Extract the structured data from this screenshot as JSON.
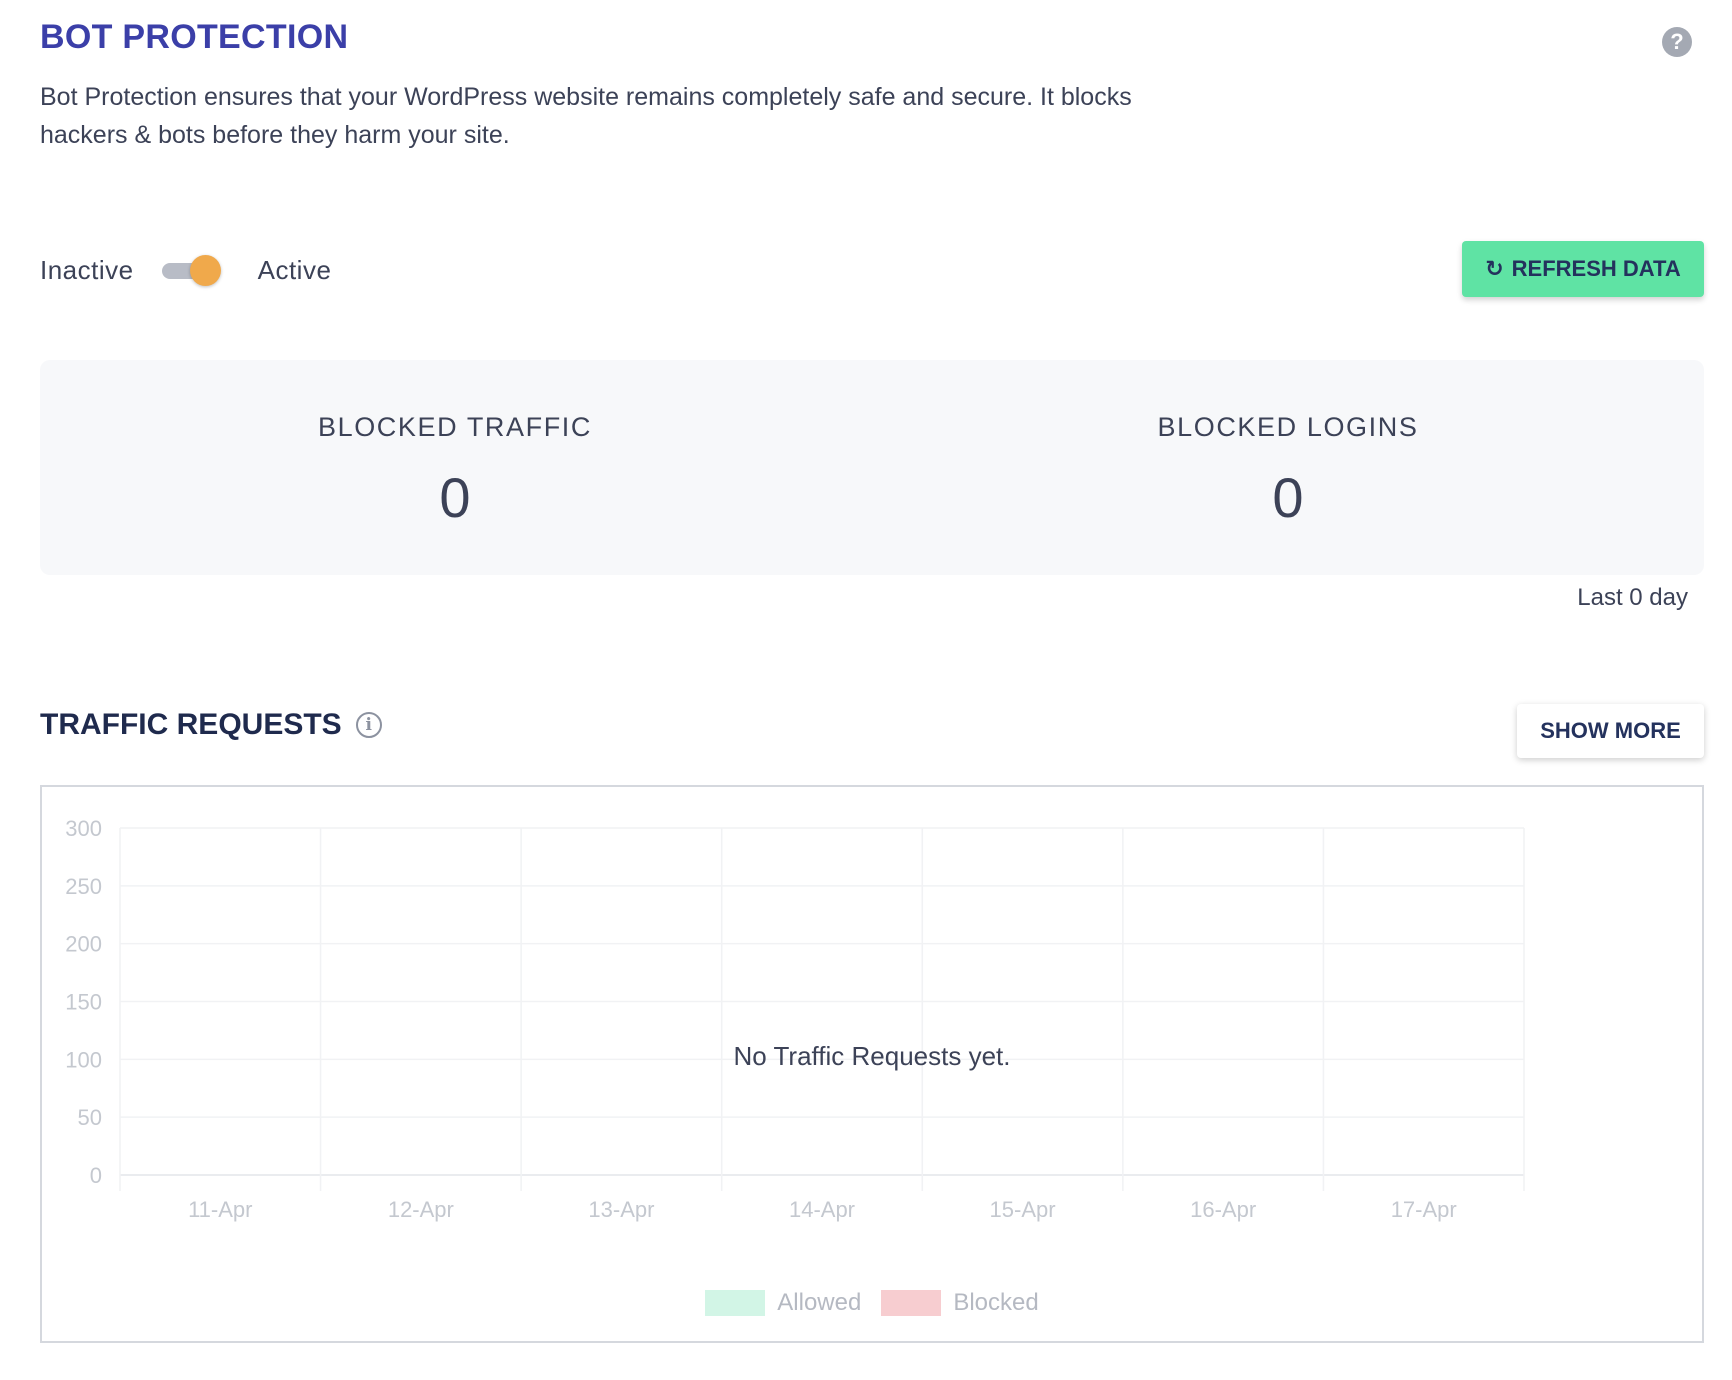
{
  "header": {
    "title": "BOT PROTECTION",
    "help_icon": "?",
    "description": "Bot Protection ensures that your WordPress website remains completely safe and secure. It blocks hackers & bots before they harm your site."
  },
  "status": {
    "inactive_label": "Inactive",
    "active_label": "Active",
    "is_active": true
  },
  "toolbar": {
    "refresh_icon": "↻",
    "refresh_label": "REFRESH DATA"
  },
  "stats": {
    "blocked_traffic_label": "BLOCKED TRAFFIC",
    "blocked_traffic_value": "0",
    "blocked_logins_label": "BLOCKED LOGINS",
    "blocked_logins_value": "0",
    "period": "Last 0 day"
  },
  "traffic": {
    "title": "TRAFFIC REQUESTS",
    "info_icon": "i",
    "show_more_label": "SHOW MORE",
    "empty_message": "No Traffic Requests yet."
  },
  "colors": {
    "accent": "#3b3fa8",
    "refresh_button": "#5fe3a4",
    "toggle_knob": "#f0a94b",
    "allowed": "#d2f5e6",
    "blocked": "#f7cdd0"
  },
  "chart_data": {
    "type": "bar",
    "categories": [
      "11-Apr",
      "12-Apr",
      "13-Apr",
      "14-Apr",
      "15-Apr",
      "16-Apr",
      "17-Apr"
    ],
    "series": [
      {
        "name": "Allowed",
        "values": [
          0,
          0,
          0,
          0,
          0,
          0,
          0
        ]
      },
      {
        "name": "Blocked",
        "values": [
          0,
          0,
          0,
          0,
          0,
          0,
          0
        ]
      }
    ],
    "yticks": [
      0,
      50,
      100,
      150,
      200,
      250,
      300
    ],
    "ylim": [
      0,
      300
    ],
    "grid": true,
    "legend": "bottom-center"
  }
}
